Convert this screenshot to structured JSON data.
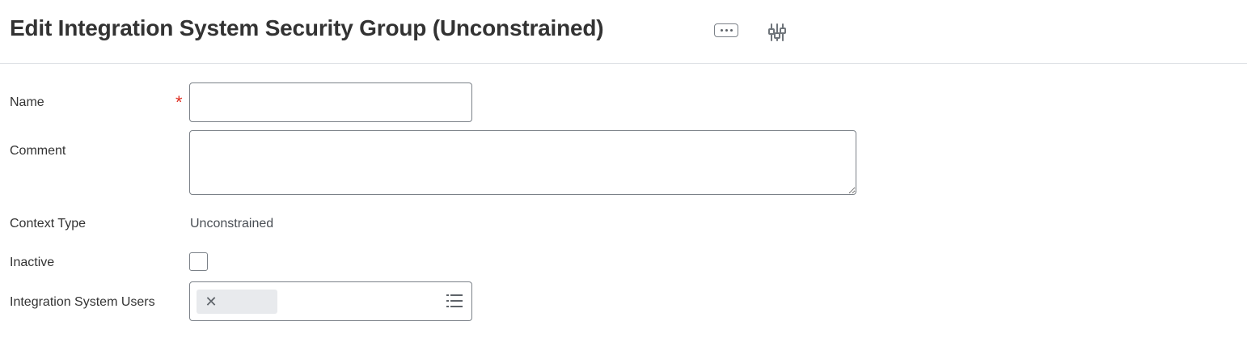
{
  "header": {
    "title": "Edit Integration System Security Group (Unconstrained)",
    "more_icon": "ellipsis-icon",
    "config_icon": "sliders-icon"
  },
  "form": {
    "name": {
      "label": "Name",
      "required_mark": "*",
      "value": ""
    },
    "comment": {
      "label": "Comment",
      "value": ""
    },
    "context_type": {
      "label": "Context Type",
      "value": "Unconstrained"
    },
    "inactive": {
      "label": "Inactive",
      "checked": false
    },
    "integration_system_users": {
      "label": "Integration System Users",
      "remove_glyph": "✕",
      "selected_pill_text": "",
      "list_icon": "list-icon"
    }
  },
  "colors": {
    "required": "#de2e21",
    "border": "#7b8188",
    "pill": "#e8eaed",
    "divider": "#dfe2e6"
  }
}
